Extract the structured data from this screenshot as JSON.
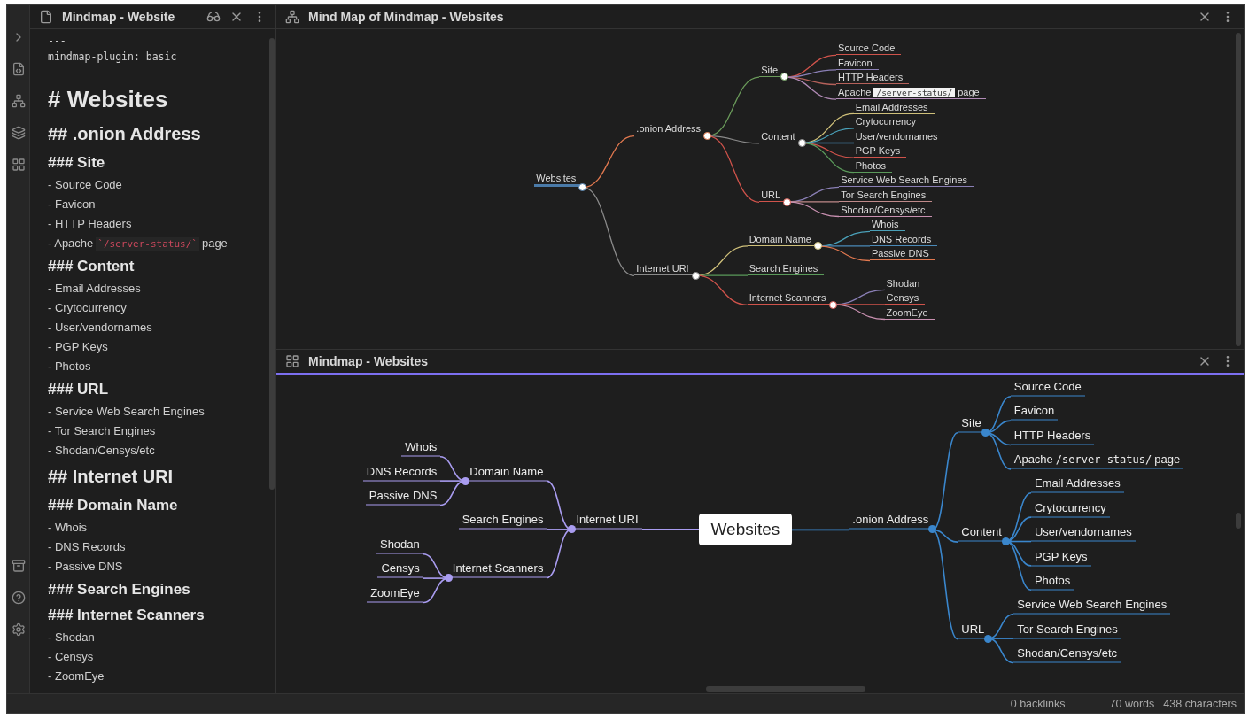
{
  "editor": {
    "title": "Mindmap - Website",
    "lines": [
      {
        "kind": "frontmatter",
        "text": "---"
      },
      {
        "kind": "frontmatter",
        "text": "mindmap-plugin: basic"
      },
      {
        "kind": "frontmatter",
        "text": "---"
      },
      {
        "kind": "h1",
        "text": "# Websites"
      },
      {
        "kind": "h2",
        "text": "## .onion Address"
      },
      {
        "kind": "h3",
        "text": "### Site"
      },
      {
        "kind": "bullet",
        "text": "- Source Code"
      },
      {
        "kind": "bullet",
        "text": "- Favicon"
      },
      {
        "kind": "bullet",
        "text": "- HTTP Headers"
      },
      {
        "kind": "bullet",
        "text": "- Apache",
        "code": "`/server-status/`",
        "after": "page"
      },
      {
        "kind": "h3",
        "text": "### Content"
      },
      {
        "kind": "bullet",
        "text": "- Email Addresses"
      },
      {
        "kind": "bullet",
        "text": "- Crytocurrency"
      },
      {
        "kind": "bullet",
        "text": "- User/vendornames"
      },
      {
        "kind": "bullet",
        "text": "- PGP Keys"
      },
      {
        "kind": "bullet",
        "text": "- Photos"
      },
      {
        "kind": "h3",
        "text": "### URL"
      },
      {
        "kind": "bullet",
        "text": "- Service Web Search Engines"
      },
      {
        "kind": "bullet",
        "text": "- Tor Search Engines"
      },
      {
        "kind": "bullet",
        "text": "- Shodan/Censys/etc"
      },
      {
        "kind": "h2",
        "text": "## Internet URI"
      },
      {
        "kind": "h3",
        "text": "### Domain Name"
      },
      {
        "kind": "bullet",
        "text": "- Whois"
      },
      {
        "kind": "bullet",
        "text": "- DNS Records"
      },
      {
        "kind": "bullet",
        "text": "- Passive DNS"
      },
      {
        "kind": "h3",
        "text": "### Search Engines"
      },
      {
        "kind": "h3",
        "text": "### Internet Scanners"
      },
      {
        "kind": "bullet",
        "text": "- Shodan"
      },
      {
        "kind": "bullet",
        "text": "- Censys"
      },
      {
        "kind": "bullet",
        "text": "- ZoomEye"
      }
    ]
  },
  "mind_map_view": {
    "title": "Mind Map of Mindmap - Websites",
    "root": {
      "label": "Websites",
      "color": "#4a7aa8",
      "children": [
        {
          "label": ".onion Address",
          "color": "#e0784f",
          "children": [
            {
              "label": "Site",
              "color": "#6a9a5a",
              "children": [
                {
                  "label": "Source Code",
                  "color": "#d0534b"
                },
                {
                  "label": "Favicon",
                  "color": "#8a7fb5"
                },
                {
                  "label": "HTTP Headers",
                  "color": "#b5615a"
                },
                {
                  "label": "Apache",
                  "code": "/server-status/",
                  "after": "page",
                  "color": "#b08ab5"
                }
              ]
            },
            {
              "label": "Content",
              "color": "#8a8a8a",
              "children": [
                {
                  "label": "Email Addresses",
                  "color": "#cfc07a"
                },
                {
                  "label": "Crytocurrency",
                  "color": "#4aa0b8"
                },
                {
                  "label": "User/vendornames",
                  "color": "#4a8ab8"
                },
                {
                  "label": "PGP Keys",
                  "color": "#d0534b"
                },
                {
                  "label": "Photos",
                  "color": "#5a9a5a"
                }
              ]
            },
            {
              "label": "URL",
              "color": "#d0534b",
              "children": [
                {
                  "label": "Service Web Search Engines",
                  "color": "#8a7fb5"
                },
                {
                  "label": "Tor Search Engines",
                  "color": "#c08a8a"
                },
                {
                  "label": "Shodan/Censys/etc",
                  "color": "#c890b0"
                }
              ]
            }
          ]
        },
        {
          "label": "Internet URI",
          "color": "#8a8a8a",
          "children": [
            {
              "label": "Domain Name",
              "color": "#cfc07a",
              "children": [
                {
                  "label": "Whois",
                  "color": "#4aa0b8"
                },
                {
                  "label": "DNS Records",
                  "color": "#4a8ab8"
                },
                {
                  "label": "Passive DNS",
                  "color": "#e0784f"
                }
              ]
            },
            {
              "label": "Search Engines",
              "color": "#5a9a5a"
            },
            {
              "label": "Internet Scanners",
              "color": "#d0534b",
              "children": [
                {
                  "label": "Shodan",
                  "color": "#8a7fb5"
                },
                {
                  "label": "Censys",
                  "color": "#d0534b"
                },
                {
                  "label": "ZoomEye",
                  "color": "#c890b0"
                }
              ]
            }
          ]
        }
      ]
    }
  },
  "mindmap_pane": {
    "title": "Mindmap - Websites",
    "left": {
      "color": "#a99cf0",
      "node": {
        "label": "Internet URI",
        "children": [
          {
            "label": "Domain Name",
            "children": [
              {
                "label": "Whois"
              },
              {
                "label": "DNS Records"
              },
              {
                "label": "Passive DNS"
              }
            ]
          },
          {
            "label": "Search Engines"
          },
          {
            "label": "Internet Scanners",
            "children": [
              {
                "label": "Shodan"
              },
              {
                "label": "Censys"
              },
              {
                "label": "ZoomEye"
              }
            ]
          }
        ]
      }
    },
    "root": "Websites",
    "right": {
      "color": "#3a86cc",
      "node": {
        "label": ".onion Address",
        "children": [
          {
            "label": "Site",
            "children": [
              {
                "label": "Source Code"
              },
              {
                "label": "Favicon"
              },
              {
                "label": "HTTP Headers"
              },
              {
                "label": "Apache",
                "code": "/server-status/",
                "after": "page"
              }
            ]
          },
          {
            "label": "Content",
            "children": [
              {
                "label": "Email Addresses"
              },
              {
                "label": "Crytocurrency"
              },
              {
                "label": "User/vendornames"
              },
              {
                "label": "PGP Keys"
              },
              {
                "label": "Photos"
              }
            ]
          },
          {
            "label": "URL",
            "children": [
              {
                "label": "Service Web Search Engines"
              },
              {
                "label": "Tor Search Engines"
              },
              {
                "label": "Shodan/Censys/etc"
              }
            ]
          }
        ]
      }
    }
  },
  "status_bar": {
    "backlinks": "0 backlinks",
    "words": "70 words",
    "characters": "438 characters"
  }
}
